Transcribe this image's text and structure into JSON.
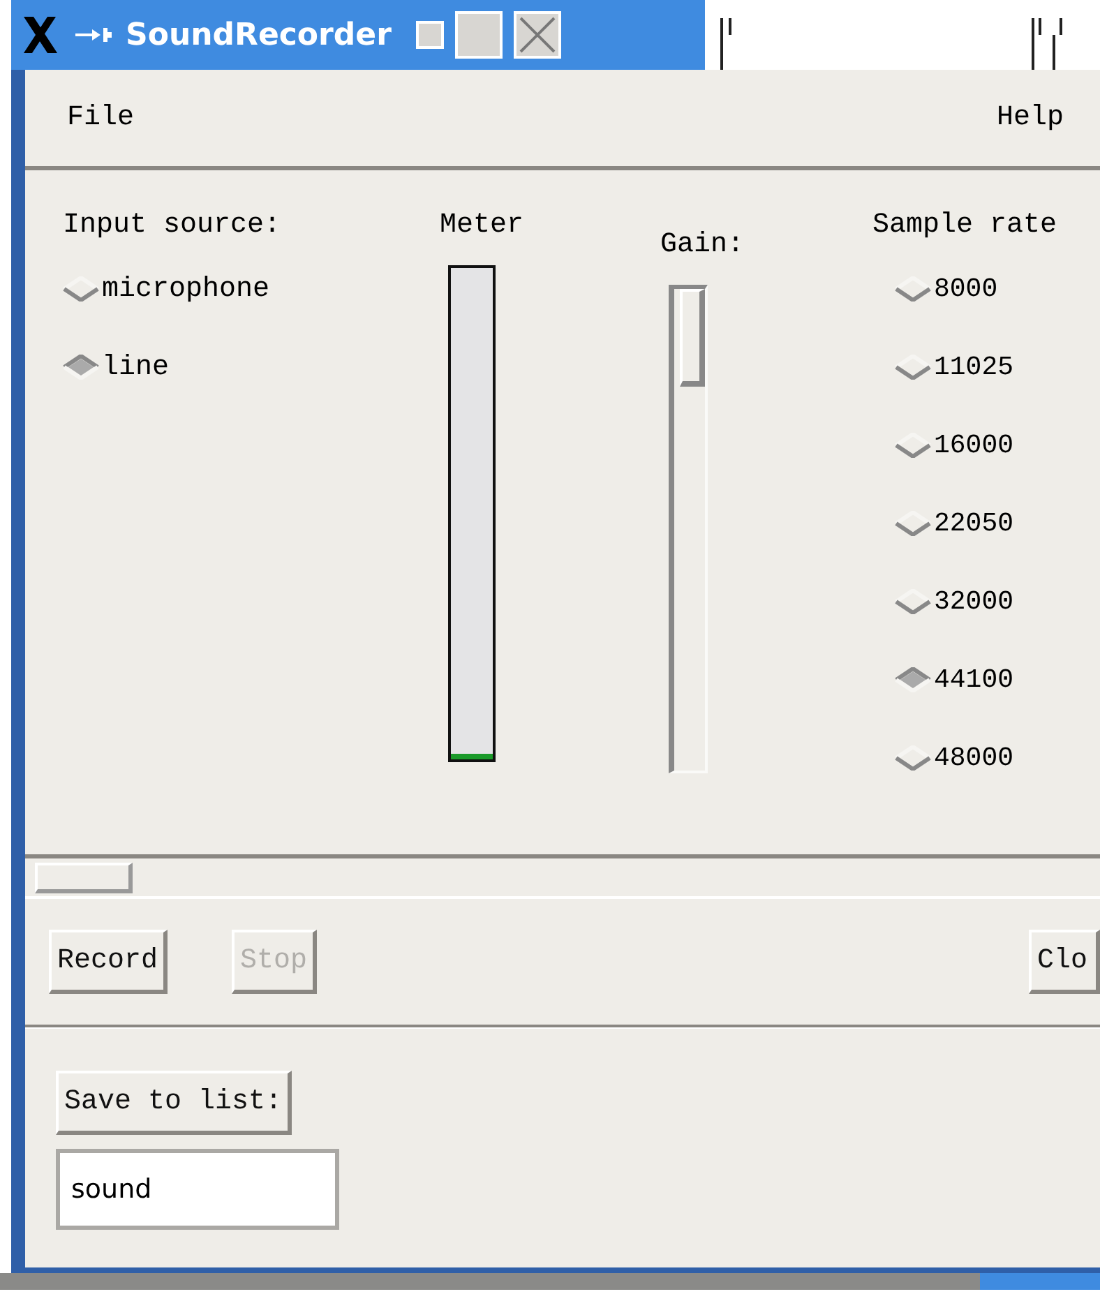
{
  "window": {
    "title": "SoundRecorder"
  },
  "menu": [
    {
      "label": "File"
    },
    {
      "label": "Help"
    }
  ],
  "input_source": {
    "label": "Input source:",
    "options": [
      {
        "label": "microphone",
        "selected": false
      },
      {
        "label": "line",
        "selected": true
      }
    ]
  },
  "meter": {
    "label": "Meter",
    "level": 0.01
  },
  "gain": {
    "label": "Gain:",
    "level": 0
  },
  "sample_rate": {
    "label": "Sample rate",
    "options": [
      {
        "label": "8000",
        "selected": false
      },
      {
        "label": "11025",
        "selected": false
      },
      {
        "label": "16000",
        "selected": false
      },
      {
        "label": "22050",
        "selected": false
      },
      {
        "label": "32000",
        "selected": false
      },
      {
        "label": "44100",
        "selected": true
      },
      {
        "label": "48000",
        "selected": false
      }
    ]
  },
  "buttons": [
    {
      "label": "Record",
      "disabled": false
    },
    {
      "label": "Stop",
      "disabled": true
    },
    {
      "label": "Clo",
      "disabled": false
    }
  ],
  "save": {
    "button": "Save to list:",
    "value": "sound"
  }
}
